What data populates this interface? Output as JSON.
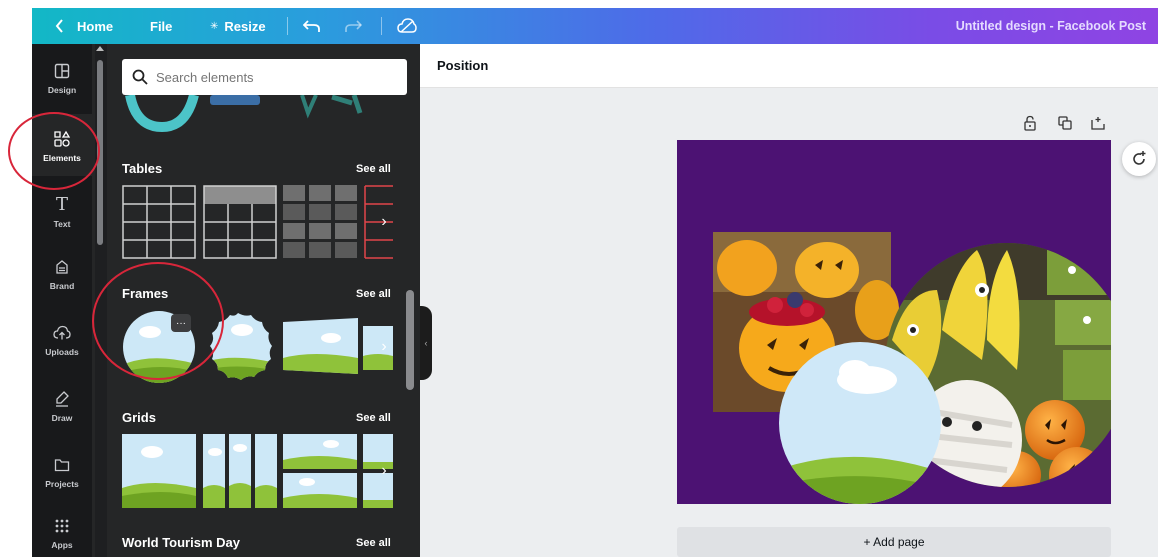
{
  "topbar": {
    "back_label": "Home",
    "file_label": "File",
    "resize_label": "Resize",
    "design_title": "Untitled design - Facebook Post",
    "icons": [
      "chevron-left-icon",
      "star-icon",
      "undo-icon",
      "redo-icon",
      "cloud-saved-icon"
    ]
  },
  "rail": {
    "items": [
      {
        "label": "Design",
        "icon": "layout-icon"
      },
      {
        "label": "Elements",
        "icon": "shapes-icon"
      },
      {
        "label": "Text",
        "icon": "text-icon"
      },
      {
        "label": "Brand",
        "icon": "brand-icon"
      },
      {
        "label": "Uploads",
        "icon": "upload-cloud-icon"
      },
      {
        "label": "Draw",
        "icon": "pen-icon"
      },
      {
        "label": "Projects",
        "icon": "folder-icon"
      },
      {
        "label": "Apps",
        "icon": "apps-grid-icon"
      }
    ],
    "active": "Elements"
  },
  "panel": {
    "search_placeholder": "Search elements",
    "see_all_label": "See all",
    "sections": [
      {
        "title": "Tables"
      },
      {
        "title": "Frames"
      },
      {
        "title": "Grids"
      },
      {
        "title": "World Tourism Day"
      }
    ],
    "frame_more_label": "···"
  },
  "editor": {
    "toolbar_label": "Position",
    "add_page_label": "+ Add page",
    "page_controls": [
      "lock-icon",
      "duplicate-icon",
      "add-page-icon"
    ],
    "page_background": "#4c1273"
  },
  "colors": {
    "annotation_ring": "#d8263a",
    "sidebar": "#18191b",
    "panel": "#252627",
    "sky": "#cbe7f9",
    "grass": "#7cb42a"
  }
}
